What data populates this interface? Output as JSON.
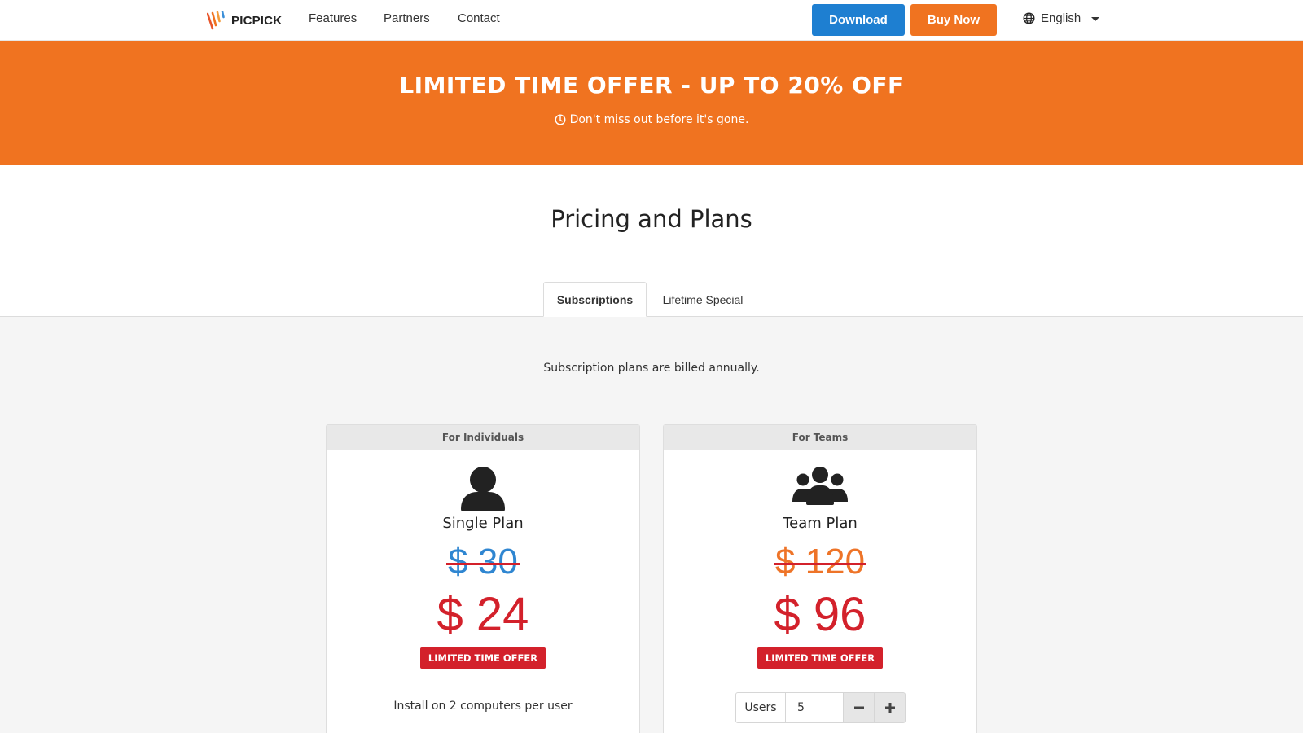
{
  "header": {
    "logo_text": "PICPICK",
    "nav": [
      "Features",
      "Partners",
      "Contact"
    ],
    "download_label": "Download",
    "buy_label": "Buy Now",
    "language": "English"
  },
  "banner": {
    "title": "LIMITED TIME OFFER - UP TO 20% OFF",
    "subtitle": "Don't miss out before it's gone."
  },
  "page_title": "Pricing and Plans",
  "tabs": {
    "items": [
      "Subscriptions",
      "Lifetime Special"
    ],
    "active": "Subscriptions"
  },
  "billing_note": "Subscription plans are billed annually.",
  "plans": {
    "individual": {
      "header": "For Individuals",
      "icon": "user-icon",
      "name": "Single Plan",
      "old_price": "$ 30",
      "new_price": "$ 24",
      "badge": "LIMITED TIME OFFER",
      "note": "Install on 2 computers per user"
    },
    "team": {
      "header": "For Teams",
      "icon": "users-icon",
      "name": "Team Plan",
      "old_price": "$ 120",
      "new_price": "$ 96",
      "badge": "LIMITED TIME OFFER",
      "users_label": "Users",
      "users_value": "5"
    }
  },
  "colors": {
    "brand_orange": "#f07320",
    "brand_blue": "#1e7fd1",
    "offer_red": "#d3212b",
    "old_price_blue": "#2f86d1",
    "old_price_orange": "#ee7428"
  }
}
